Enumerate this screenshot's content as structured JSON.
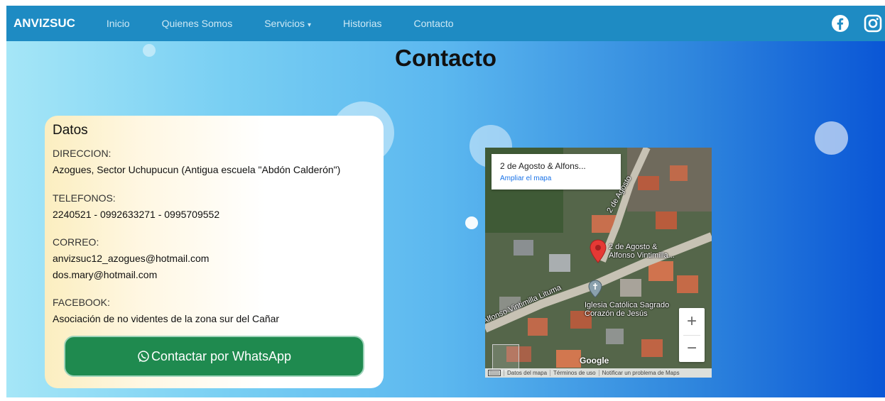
{
  "nav": {
    "brand": "ANVIZSUC",
    "links": [
      "Inicio",
      "Quienes Somos",
      "Servicios",
      "Historias",
      "Contacto"
    ],
    "dropdown_caret": "▾"
  },
  "page": {
    "title": "Contacto"
  },
  "card": {
    "title": "Datos",
    "direccion_label": "DIRECCION:",
    "direccion_value": "Azogues, Sector Uchupucun (Antigua escuela \"Abdón Calderón\")",
    "telefonos_label": "TELEFONOS:",
    "telefonos_value": "2240521 - 0992633271 - 0995709552",
    "correo_label": "CORREO:",
    "correo_1": "anvizsuc12_azogues@hotmail.com",
    "correo_2": "dos.mary@hotmail.com",
    "facebook_label": "FACEBOOK:",
    "facebook_value": "Asociación de no videntes de la zona sur del Cañar",
    "whatsapp_button": "Contactar por WhatsApp"
  },
  "map": {
    "info_title": "2 de Agosto & Alfons...",
    "info_link": "Ampliar el mapa",
    "pin_label_1": "2 de Agosto &",
    "pin_label_2": "Alfonso Vintimilla...",
    "street_1": "2 de Agosto",
    "street_2": "Alfonso Vintimilla Lituma",
    "church_1": "Iglesia Católica Sagrado",
    "church_2": "Corazón de Jesús",
    "zoom_in": "+",
    "zoom_out": "−",
    "google": "Google",
    "footer": [
      "Datos del mapa",
      "Términos de uso",
      "Notificar un problema de Maps"
    ]
  },
  "colors": {
    "navbar": "#1e8bc3",
    "button": "#1f8a4f",
    "pin": "#e53935",
    "link": "#1a73e8"
  },
  "icons": [
    "facebook-icon",
    "instagram-icon",
    "whatsapp-icon",
    "map-pin-icon",
    "church-pin-icon",
    "keyboard-icon",
    "streetview-icon"
  ]
}
